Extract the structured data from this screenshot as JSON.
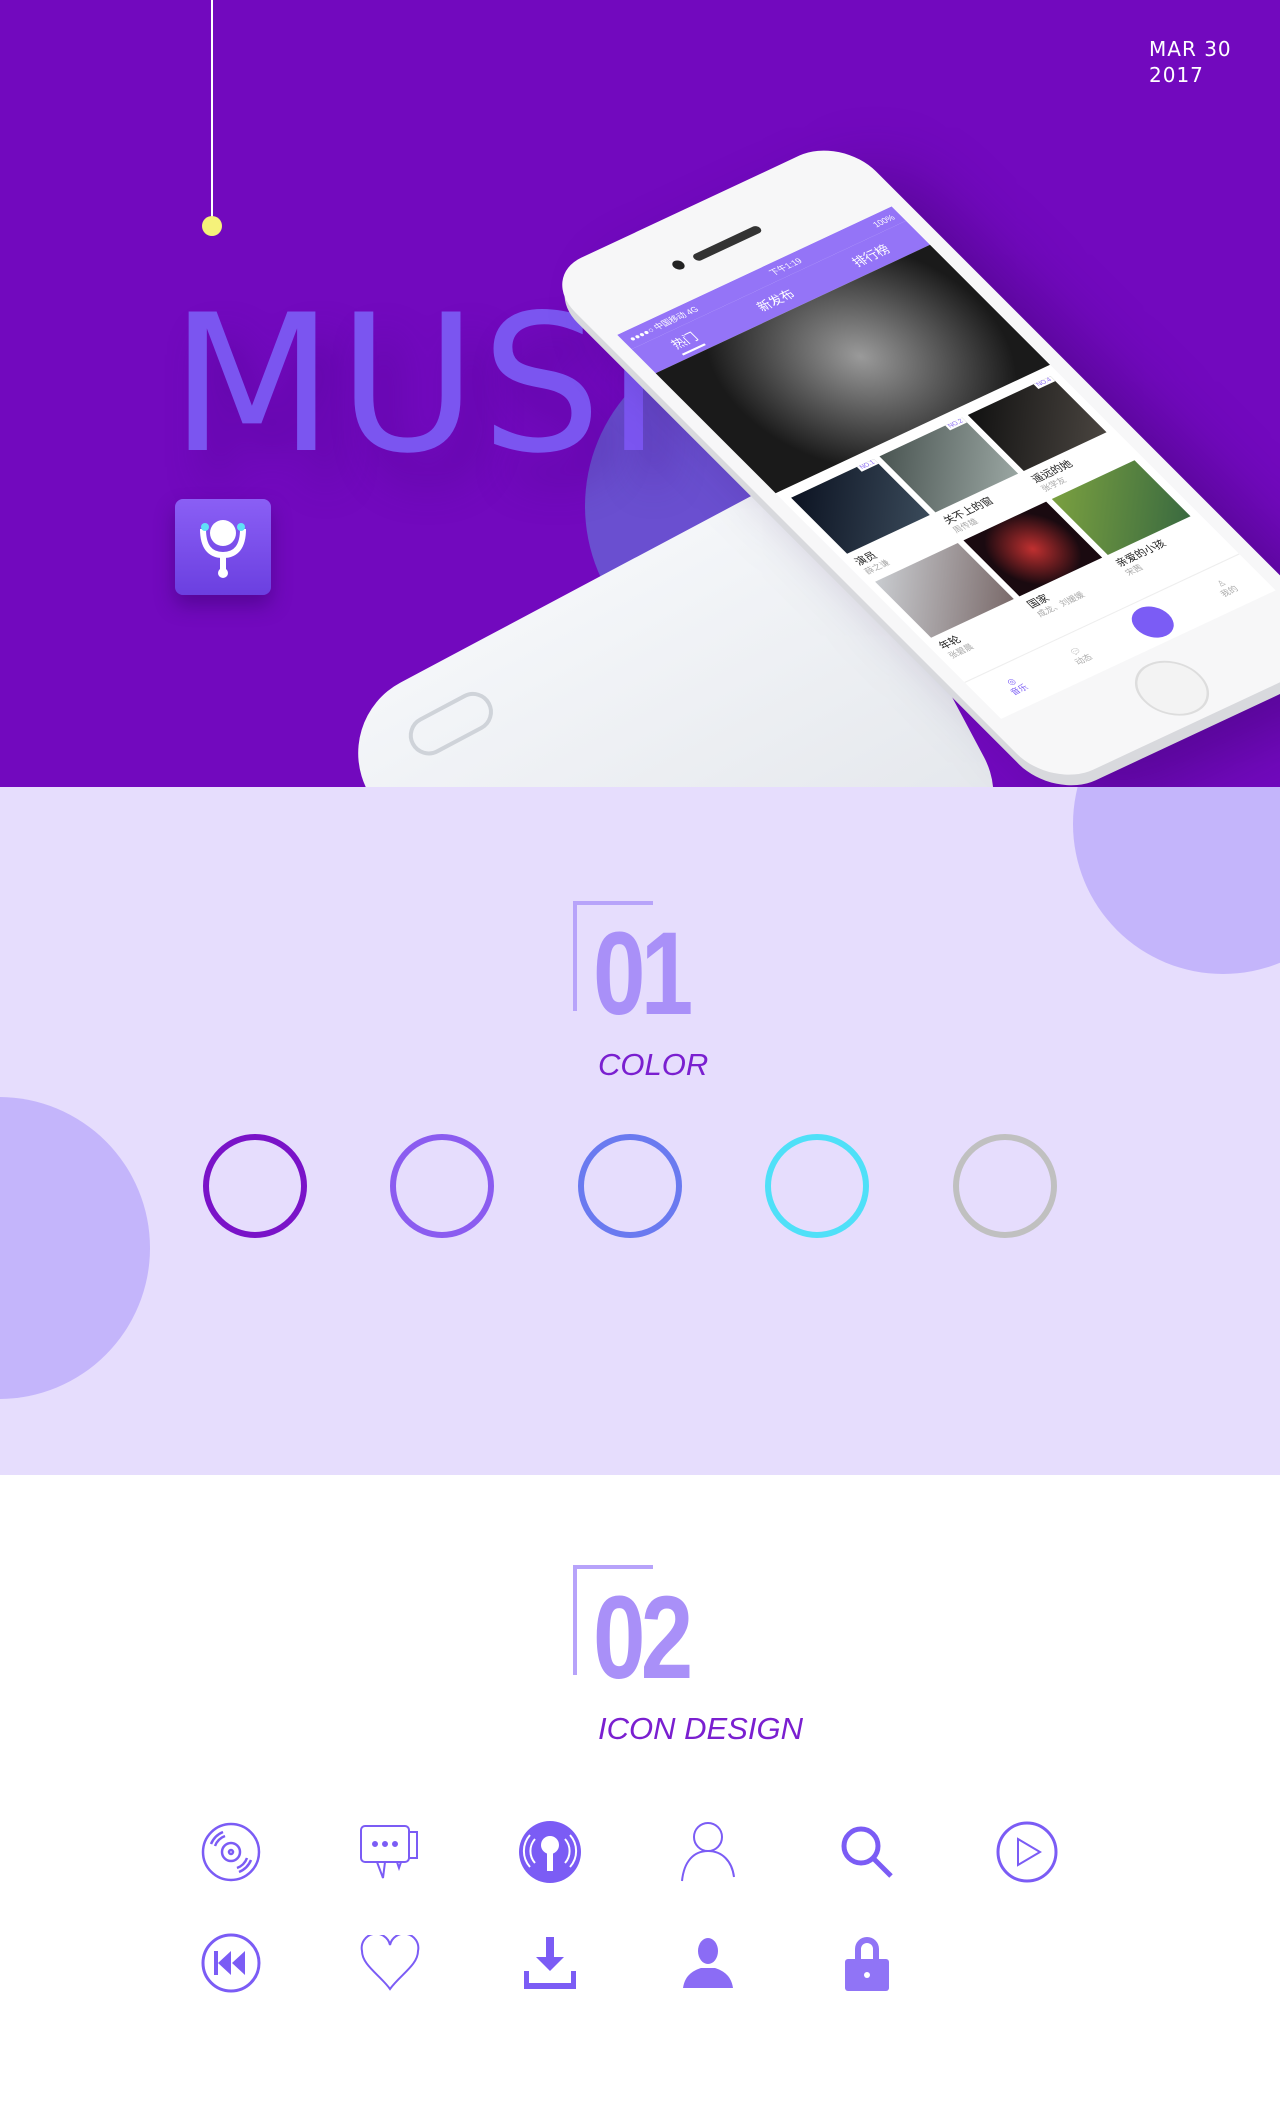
{
  "hero": {
    "date_line1": "MAR 30",
    "date_line2": "2017",
    "title": "MUSI",
    "background_color": "#7209be",
    "phone": {
      "status": {
        "signal": "●●●●○ 中国移动 4G",
        "time": "下午1:19",
        "battery": "100%"
      },
      "tabs": [
        {
          "label": "热门",
          "active": true
        },
        {
          "label": "新发布"
        },
        {
          "label": "排行榜"
        }
      ],
      "albums": [
        {
          "badge": "NO.1",
          "title": "演员",
          "artist": "薛之谦"
        },
        {
          "badge": "NO.2",
          "title": "关不上的窗",
          "artist": "周传雄"
        },
        {
          "badge": "NO.4",
          "title": "遥远的她",
          "artist": "张学友"
        },
        {
          "badge": "",
          "title": "年轮",
          "artist": "张碧晨"
        },
        {
          "badge": "",
          "title": "国家",
          "artist": "成龙、刘媛媛"
        },
        {
          "badge": "",
          "title": "亲爱的小孩",
          "artist": "宋茜"
        }
      ],
      "tabbar": [
        {
          "label": "音乐",
          "icon": "music-disc-icon",
          "active": true
        },
        {
          "label": "动态",
          "icon": "chat-icon"
        },
        {
          "label": "",
          "icon": "microphone-icon"
        },
        {
          "label": "我的",
          "icon": "user-icon"
        }
      ]
    }
  },
  "color_section": {
    "number": "01",
    "label": "COLOR",
    "swatches": [
      "#7a13c8",
      "#8b5cf0",
      "#6a7af0",
      "#4fe0f8",
      "#c0c0c0"
    ]
  },
  "icon_section": {
    "number": "02",
    "label": "ICON DESIGN",
    "icons": [
      "disc-icon",
      "chat-icon",
      "microphone-icon",
      "user-outline-icon",
      "search-icon",
      "play-icon",
      "rewind-icon",
      "heart-icon",
      "download-icon",
      "user-filled-icon",
      "lock-icon"
    ],
    "accent": "#7b5cf5"
  }
}
